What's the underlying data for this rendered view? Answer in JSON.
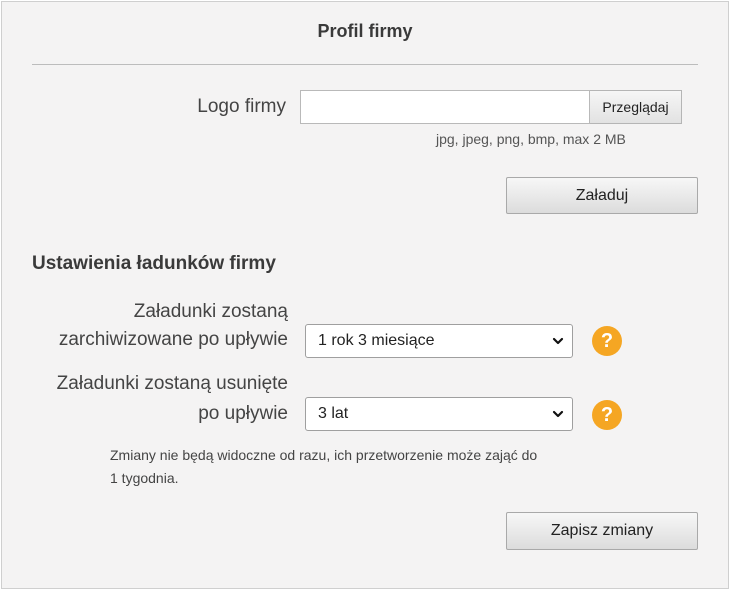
{
  "header": {
    "title": "Profil firmy"
  },
  "logo": {
    "label": "Logo firmy",
    "browse_label": "Przeglądaj",
    "hint": "jpg, jpeg, png, bmp, max 2 MB",
    "upload_label": "Załaduj"
  },
  "settings": {
    "title": "Ustawienia ładunków firmy",
    "archive": {
      "label_line1": "Załadunki zostaną",
      "label_line2": "zarchiwizowane po upływie",
      "selected": "1 rok 3 miesiące",
      "help_icon": "?"
    },
    "delete": {
      "label_line1": "Załadunki zostaną usunięte",
      "label_line2": "po upływie",
      "selected": "3 lat",
      "help_icon": "?"
    },
    "note_line1": "Zmiany nie będą widoczne od razu, ich przetworzenie może zająć do",
    "note_line2": "1 tygodnia.",
    "save_label": "Zapisz zmiany"
  },
  "colors": {
    "panel_bg": "#f4f3f3",
    "help_icon_bg": "#f5a623",
    "text": "#444444"
  }
}
